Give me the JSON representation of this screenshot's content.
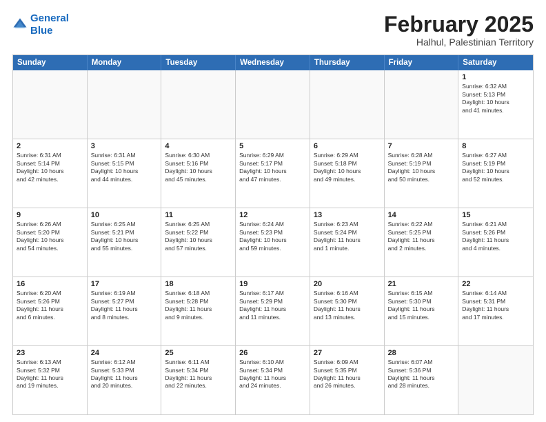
{
  "logo": {
    "line1": "General",
    "line2": "Blue"
  },
  "title": "February 2025",
  "subtitle": "Halhul, Palestinian Territory",
  "dayNames": [
    "Sunday",
    "Monday",
    "Tuesday",
    "Wednesday",
    "Thursday",
    "Friday",
    "Saturday"
  ],
  "weeks": [
    [
      {
        "date": "",
        "info": ""
      },
      {
        "date": "",
        "info": ""
      },
      {
        "date": "",
        "info": ""
      },
      {
        "date": "",
        "info": ""
      },
      {
        "date": "",
        "info": ""
      },
      {
        "date": "",
        "info": ""
      },
      {
        "date": "1",
        "info": "Sunrise: 6:32 AM\nSunset: 5:13 PM\nDaylight: 10 hours\nand 41 minutes."
      }
    ],
    [
      {
        "date": "2",
        "info": "Sunrise: 6:31 AM\nSunset: 5:14 PM\nDaylight: 10 hours\nand 42 minutes."
      },
      {
        "date": "3",
        "info": "Sunrise: 6:31 AM\nSunset: 5:15 PM\nDaylight: 10 hours\nand 44 minutes."
      },
      {
        "date": "4",
        "info": "Sunrise: 6:30 AM\nSunset: 5:16 PM\nDaylight: 10 hours\nand 45 minutes."
      },
      {
        "date": "5",
        "info": "Sunrise: 6:29 AM\nSunset: 5:17 PM\nDaylight: 10 hours\nand 47 minutes."
      },
      {
        "date": "6",
        "info": "Sunrise: 6:29 AM\nSunset: 5:18 PM\nDaylight: 10 hours\nand 49 minutes."
      },
      {
        "date": "7",
        "info": "Sunrise: 6:28 AM\nSunset: 5:19 PM\nDaylight: 10 hours\nand 50 minutes."
      },
      {
        "date": "8",
        "info": "Sunrise: 6:27 AM\nSunset: 5:19 PM\nDaylight: 10 hours\nand 52 minutes."
      }
    ],
    [
      {
        "date": "9",
        "info": "Sunrise: 6:26 AM\nSunset: 5:20 PM\nDaylight: 10 hours\nand 54 minutes."
      },
      {
        "date": "10",
        "info": "Sunrise: 6:25 AM\nSunset: 5:21 PM\nDaylight: 10 hours\nand 55 minutes."
      },
      {
        "date": "11",
        "info": "Sunrise: 6:25 AM\nSunset: 5:22 PM\nDaylight: 10 hours\nand 57 minutes."
      },
      {
        "date": "12",
        "info": "Sunrise: 6:24 AM\nSunset: 5:23 PM\nDaylight: 10 hours\nand 59 minutes."
      },
      {
        "date": "13",
        "info": "Sunrise: 6:23 AM\nSunset: 5:24 PM\nDaylight: 11 hours\nand 1 minute."
      },
      {
        "date": "14",
        "info": "Sunrise: 6:22 AM\nSunset: 5:25 PM\nDaylight: 11 hours\nand 2 minutes."
      },
      {
        "date": "15",
        "info": "Sunrise: 6:21 AM\nSunset: 5:26 PM\nDaylight: 11 hours\nand 4 minutes."
      }
    ],
    [
      {
        "date": "16",
        "info": "Sunrise: 6:20 AM\nSunset: 5:26 PM\nDaylight: 11 hours\nand 6 minutes."
      },
      {
        "date": "17",
        "info": "Sunrise: 6:19 AM\nSunset: 5:27 PM\nDaylight: 11 hours\nand 8 minutes."
      },
      {
        "date": "18",
        "info": "Sunrise: 6:18 AM\nSunset: 5:28 PM\nDaylight: 11 hours\nand 9 minutes."
      },
      {
        "date": "19",
        "info": "Sunrise: 6:17 AM\nSunset: 5:29 PM\nDaylight: 11 hours\nand 11 minutes."
      },
      {
        "date": "20",
        "info": "Sunrise: 6:16 AM\nSunset: 5:30 PM\nDaylight: 11 hours\nand 13 minutes."
      },
      {
        "date": "21",
        "info": "Sunrise: 6:15 AM\nSunset: 5:30 PM\nDaylight: 11 hours\nand 15 minutes."
      },
      {
        "date": "22",
        "info": "Sunrise: 6:14 AM\nSunset: 5:31 PM\nDaylight: 11 hours\nand 17 minutes."
      }
    ],
    [
      {
        "date": "23",
        "info": "Sunrise: 6:13 AM\nSunset: 5:32 PM\nDaylight: 11 hours\nand 19 minutes."
      },
      {
        "date": "24",
        "info": "Sunrise: 6:12 AM\nSunset: 5:33 PM\nDaylight: 11 hours\nand 20 minutes."
      },
      {
        "date": "25",
        "info": "Sunrise: 6:11 AM\nSunset: 5:34 PM\nDaylight: 11 hours\nand 22 minutes."
      },
      {
        "date": "26",
        "info": "Sunrise: 6:10 AM\nSunset: 5:34 PM\nDaylight: 11 hours\nand 24 minutes."
      },
      {
        "date": "27",
        "info": "Sunrise: 6:09 AM\nSunset: 5:35 PM\nDaylight: 11 hours\nand 26 minutes."
      },
      {
        "date": "28",
        "info": "Sunrise: 6:07 AM\nSunset: 5:36 PM\nDaylight: 11 hours\nand 28 minutes."
      },
      {
        "date": "",
        "info": ""
      }
    ]
  ]
}
